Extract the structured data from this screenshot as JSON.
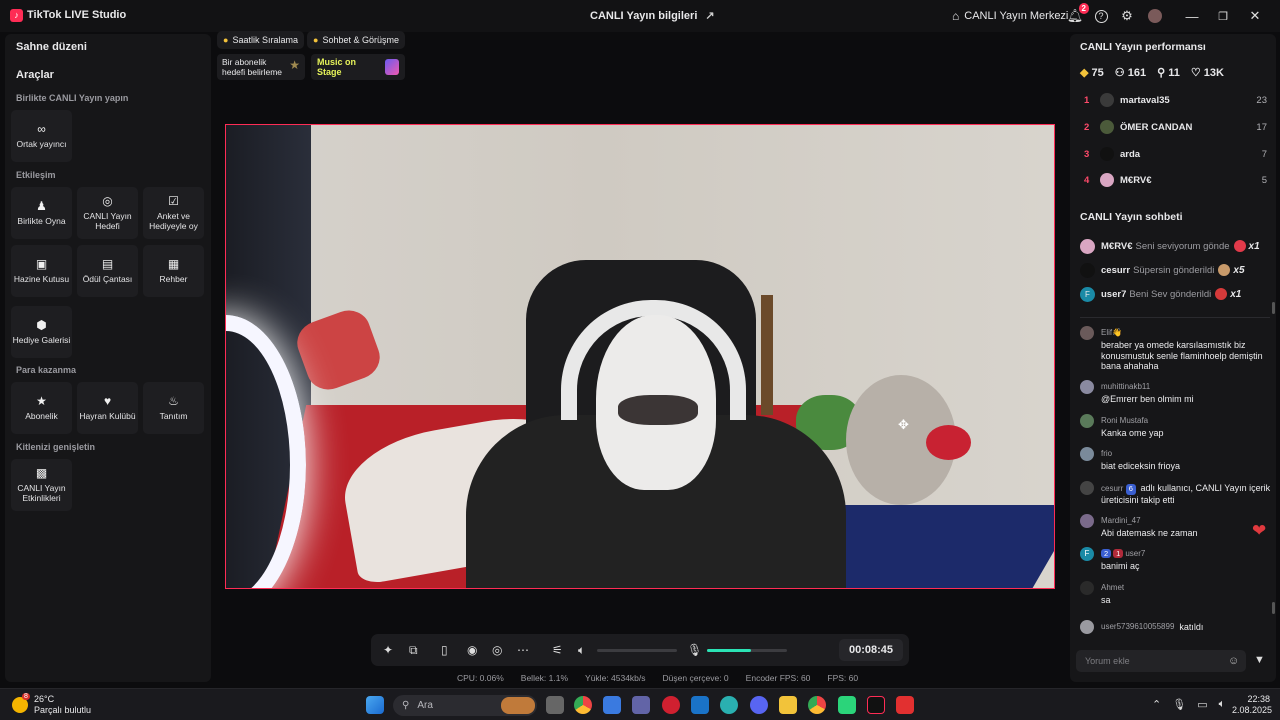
{
  "app": {
    "title": "TikTok LIVE Studio",
    "logo": "tiktok-logo"
  },
  "header": {
    "live_info": "CANLI Yayın bilgileri",
    "live_center": "CANLI Yayın Merkezi",
    "notification_count": "2"
  },
  "left": {
    "scene_layout": "Sahne düzeni",
    "tools_title": "Araçlar",
    "sections": {
      "cohost": "Birlikte CANLI Yayın yapın",
      "interaction": "Etkileşim",
      "monetize": "Para kazanma",
      "grow": "Kitlenizi genişletin"
    },
    "tools": {
      "cohost": "Ortak yayıncı",
      "play_together": "Birlikte Oyna",
      "live_goal": "CANLI Yayın Hedefi",
      "poll": "Anket ve Hediyeyle oy",
      "treasure": "Hazine Kutusu",
      "reward_bag": "Ödül Çantası",
      "guide": "Rehber",
      "gift_gallery": "Hediye Galerisi",
      "subscription": "Abonelik",
      "fan_club": "Hayran Kulübü",
      "promote": "Tanıtım",
      "live_events": "CANLI Yayın Etkinlikleri"
    }
  },
  "chips": {
    "hourly_ranking": "Saatlik Sıralama",
    "chat_meet": "Sohbet & Görüşme",
    "sub_goal": "Bir abonelik hedefi belirleme",
    "music_on_stage": "Music on Stage"
  },
  "controls": {
    "timer": "00:08:45",
    "volume_level": 0.0,
    "mic_level": 0.55
  },
  "stats": {
    "cpu": "CPU:  0.06%",
    "memory": "Bellek:  1.1%",
    "upload": "Yükle:  4534kb/s",
    "dropped": "Düşen çerçeve:  0",
    "encoder_fps": "Encoder FPS:  60",
    "fps": "FPS:  60"
  },
  "right": {
    "perf_title": "CANLI Yayın performansı",
    "perf": {
      "diamonds": "75",
      "viewers": "161",
      "shares": "11",
      "likes": "13K"
    },
    "ranking": [
      {
        "rank": "1",
        "name": "martaval35",
        "score": "23",
        "color": "#3a3a3a"
      },
      {
        "rank": "2",
        "name": "ÖMER CANDAN",
        "score": "17",
        "color": "#4b5a3a"
      },
      {
        "rank": "3",
        "name": "arda",
        "score": "7",
        "color": "#111111"
      },
      {
        "rank": "4",
        "name": "M€RV€",
        "score": "5",
        "color": "#d9a6c2"
      }
    ],
    "chat_title": "CANLI Yayın sohbeti",
    "gifts": [
      {
        "name": "M€RV€",
        "msg": "Seni seviyorum gönde",
        "count": "x1",
        "color": "#d9a6c2",
        "gift_color": "#e23a4a"
      },
      {
        "name": "cesurr",
        "msg": "Süpersin gönderildi",
        "count": "x5",
        "color": "#111111",
        "gift_color": "#c89a6a"
      },
      {
        "name": "user7",
        "msg": "Beni Sev gönderildi",
        "count": "x1",
        "color": "#1a8aa6",
        "initial": "F",
        "gift_color": "#d63a3a"
      }
    ],
    "messages": [
      {
        "user": "Elif👋",
        "text": "beraber ya omede karsılasmıstık biz konusmustuk senle flaminhoelp demiştin bana ahahaha",
        "color": "#6a5a5a"
      },
      {
        "user": "muhittinakb11",
        "text": "@Emrerr ben olmim mi",
        "color": "#8a8aa0"
      },
      {
        "user": "Roni Mustafa",
        "text": "Kanka ome yap",
        "color": "#5a7a5a"
      },
      {
        "user": "frio",
        "text": "biat ediceksin frioya",
        "color": "#7a8a9a"
      },
      {
        "user": "cesurr",
        "badge": "6",
        "text": "adlı kullanıcı, CANLI Yayın içerik üreticisini takip etti",
        "color": "#444444"
      },
      {
        "user": "Mardini_47",
        "text": "Abi datemask ne zaman",
        "color": "#7a6a8a"
      },
      {
        "user": "user7",
        "badge": "2",
        "badge2": "1",
        "text": "banimi aç",
        "color": "#1a8aa6",
        "initial": "F"
      },
      {
        "user": "Ahmet",
        "text": "sa",
        "color": "#2a2a2a"
      },
      {
        "user": "user5739610055899",
        "text": "katıldı",
        "color": "#9a9aa0"
      }
    ],
    "comment_placeholder": "Yorum ekle"
  },
  "taskbar": {
    "temp": "26°C",
    "weather": "Parçalı bulutlu",
    "weather_badge": "8",
    "search": "Ara",
    "time": "22:38",
    "date": "2.08.2025"
  }
}
